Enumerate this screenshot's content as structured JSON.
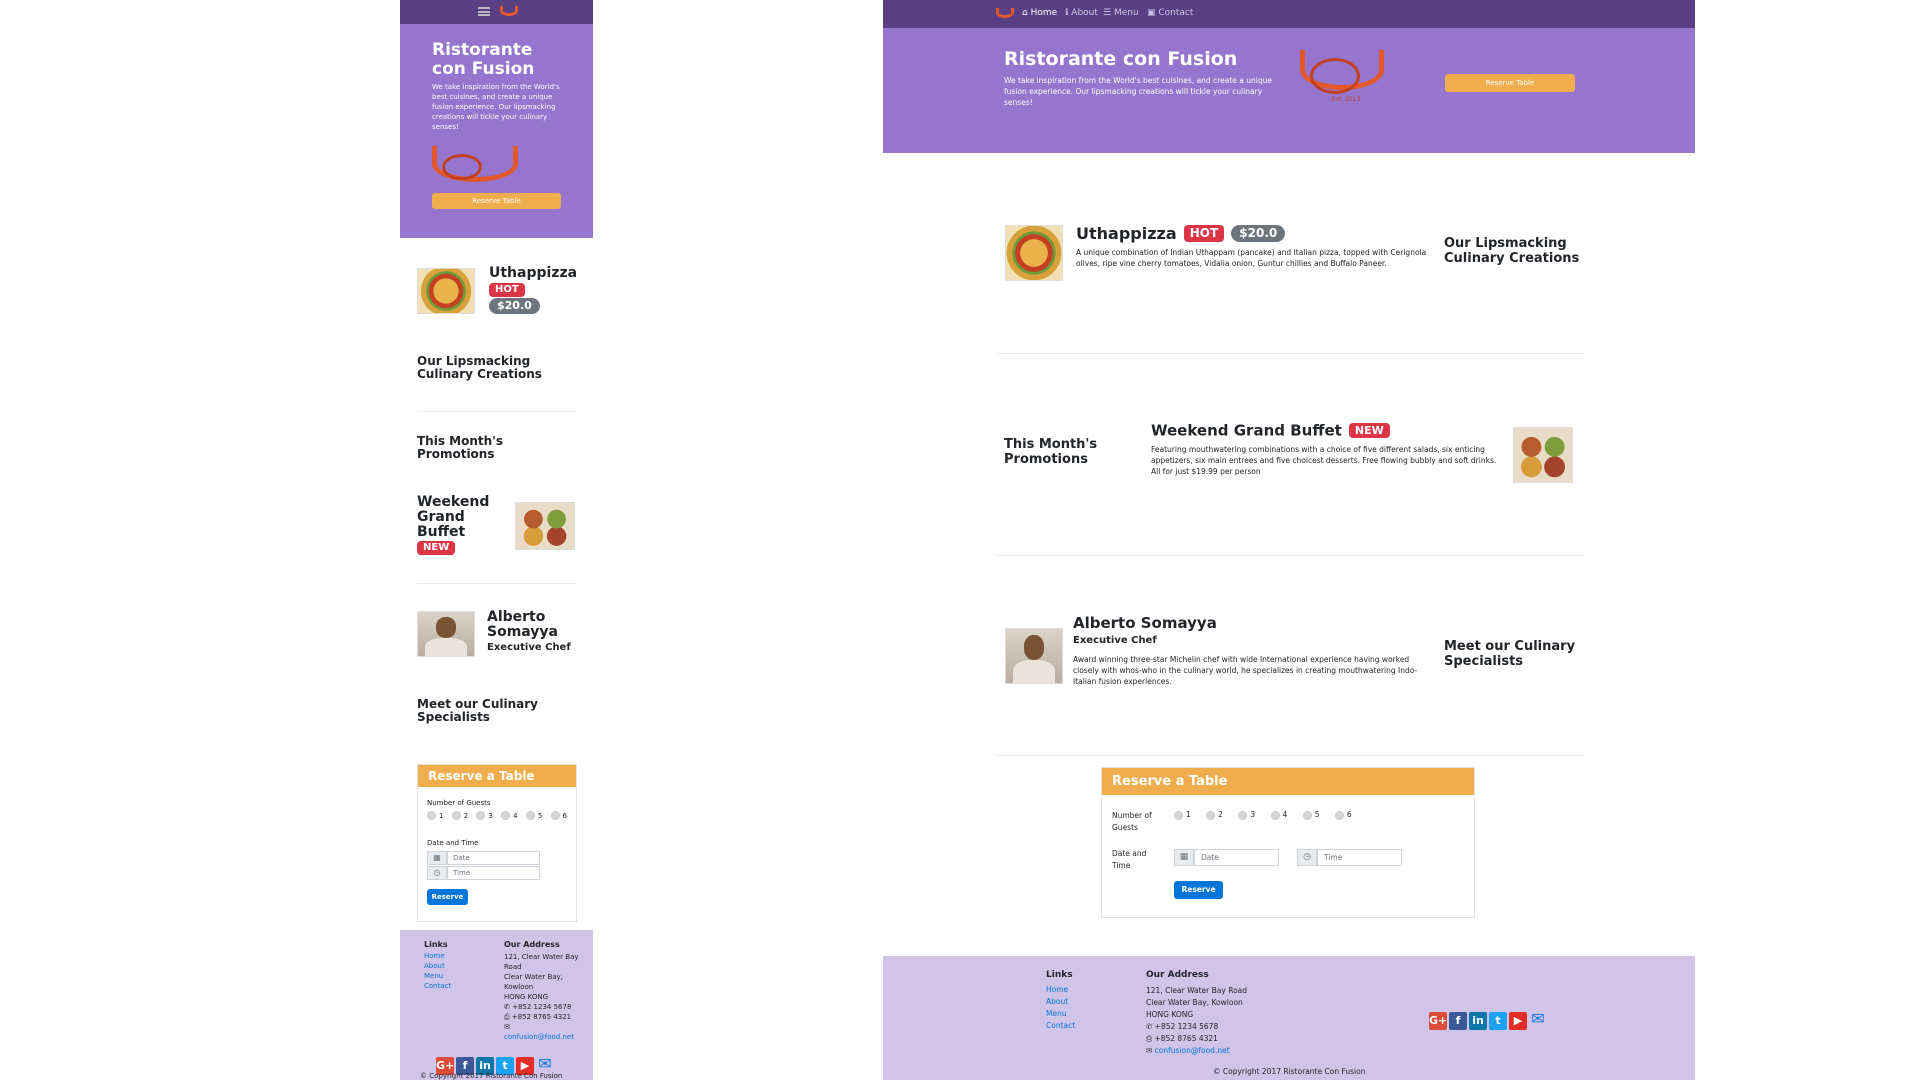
{
  "brand": {
    "name": "Ristorante con Fusion",
    "name_line1": "Ristorante",
    "name_line2": "con Fusion",
    "tagline": "We take inspiration from the World's best cuisines, and create a unique fusion experience. Our lipsmacking creations will tickle your culinary senses!",
    "reserve_button": "Reserve Table",
    "logo_year": "Est. 2013"
  },
  "nav": {
    "items": [
      {
        "label": "Home",
        "icon": "home-icon"
      },
      {
        "label": "About",
        "icon": "info-icon"
      },
      {
        "label": "Menu",
        "icon": "list-icon"
      },
      {
        "label": "Contact",
        "icon": "address-card-icon"
      }
    ]
  },
  "dish": {
    "name": "Uthappizza",
    "badge": "HOT",
    "price": "$20.0",
    "description": "A unique combination of Indian Uthappam (pancake) and Italian pizza, topped with Cerignola olives, ripe vine cherry tomatoes, Vidalia onion, Guntur chillies and Buffalo Paneer.",
    "section_heading": "Our Lipsmacking Culinary Creations",
    "section_line1": "Our Lipsmacking",
    "section_line2": "Culinary Creations"
  },
  "promotion": {
    "name": "Weekend Grand Buffet",
    "name_line1": "Weekend",
    "name_line2": "Grand",
    "name_line3": "Buffet",
    "badge": "NEW",
    "description": "Featuring mouthwatering combinations with a choice of five different salads, six enticing appetizers, six main entrees and five choicest desserts. Free flowing bubbly and soft drinks. All for just $19.99 per person",
    "section_line1": "This Month's",
    "section_line2": "Promotions"
  },
  "leader": {
    "name": "Alberto Somayya",
    "name_line1": "Alberto",
    "name_line2": "Somayya",
    "designation": "Executive Chef",
    "description": "Award winning three-star Michelin chef with wide International experience having worked closely with whos-who in the culinary world, he specializes in creating mouthwatering Indo-Italian fusion experiences.",
    "section_line1": "Meet our Culinary",
    "section_line2": "Specialists"
  },
  "reservation": {
    "header": "Reserve a Table",
    "guests_label": "Number of Guests",
    "guests_label_line1": "Number of",
    "guests_label_line2": "Guests",
    "guest_options": [
      "1",
      "2",
      "3",
      "4",
      "5",
      "6"
    ],
    "datetime_label": "Date and Time",
    "datetime_label_line1": "Date and",
    "datetime_label_line2": "Time",
    "date_placeholder": "Date",
    "time_placeholder": "Time",
    "submit": "Reserve"
  },
  "footer": {
    "links_heading": "Links",
    "links": [
      "Home",
      "About",
      "Menu",
      "Contact"
    ],
    "address_heading": "Our Address",
    "address_line1": "121, Clear Water Bay Road",
    "address_line2": "Clear Water Bay, Kowloon",
    "address_line3": "HONG KONG",
    "mobile_addr1a": "121, Clear Water Bay",
    "mobile_addr1b": "Road",
    "mobile_addr2a": "Clear Water Bay,",
    "mobile_addr2b": "Kowloon",
    "phone": "+852 1234 5678",
    "fax": "+852 8765 4321",
    "email": "confusion@food.net",
    "copyright": "© Copyright 2017 Ristorante Con Fusion",
    "social": [
      "G+",
      "f",
      "in",
      "t",
      "▶",
      "✉"
    ]
  },
  "colors": {
    "navbar": "#5b3f85",
    "jumbotron": "#9575cd",
    "footer": "#d1c4e9",
    "accent": "#f0ad4e",
    "badge_danger": "#dc3545",
    "primary": "#0275d8"
  }
}
